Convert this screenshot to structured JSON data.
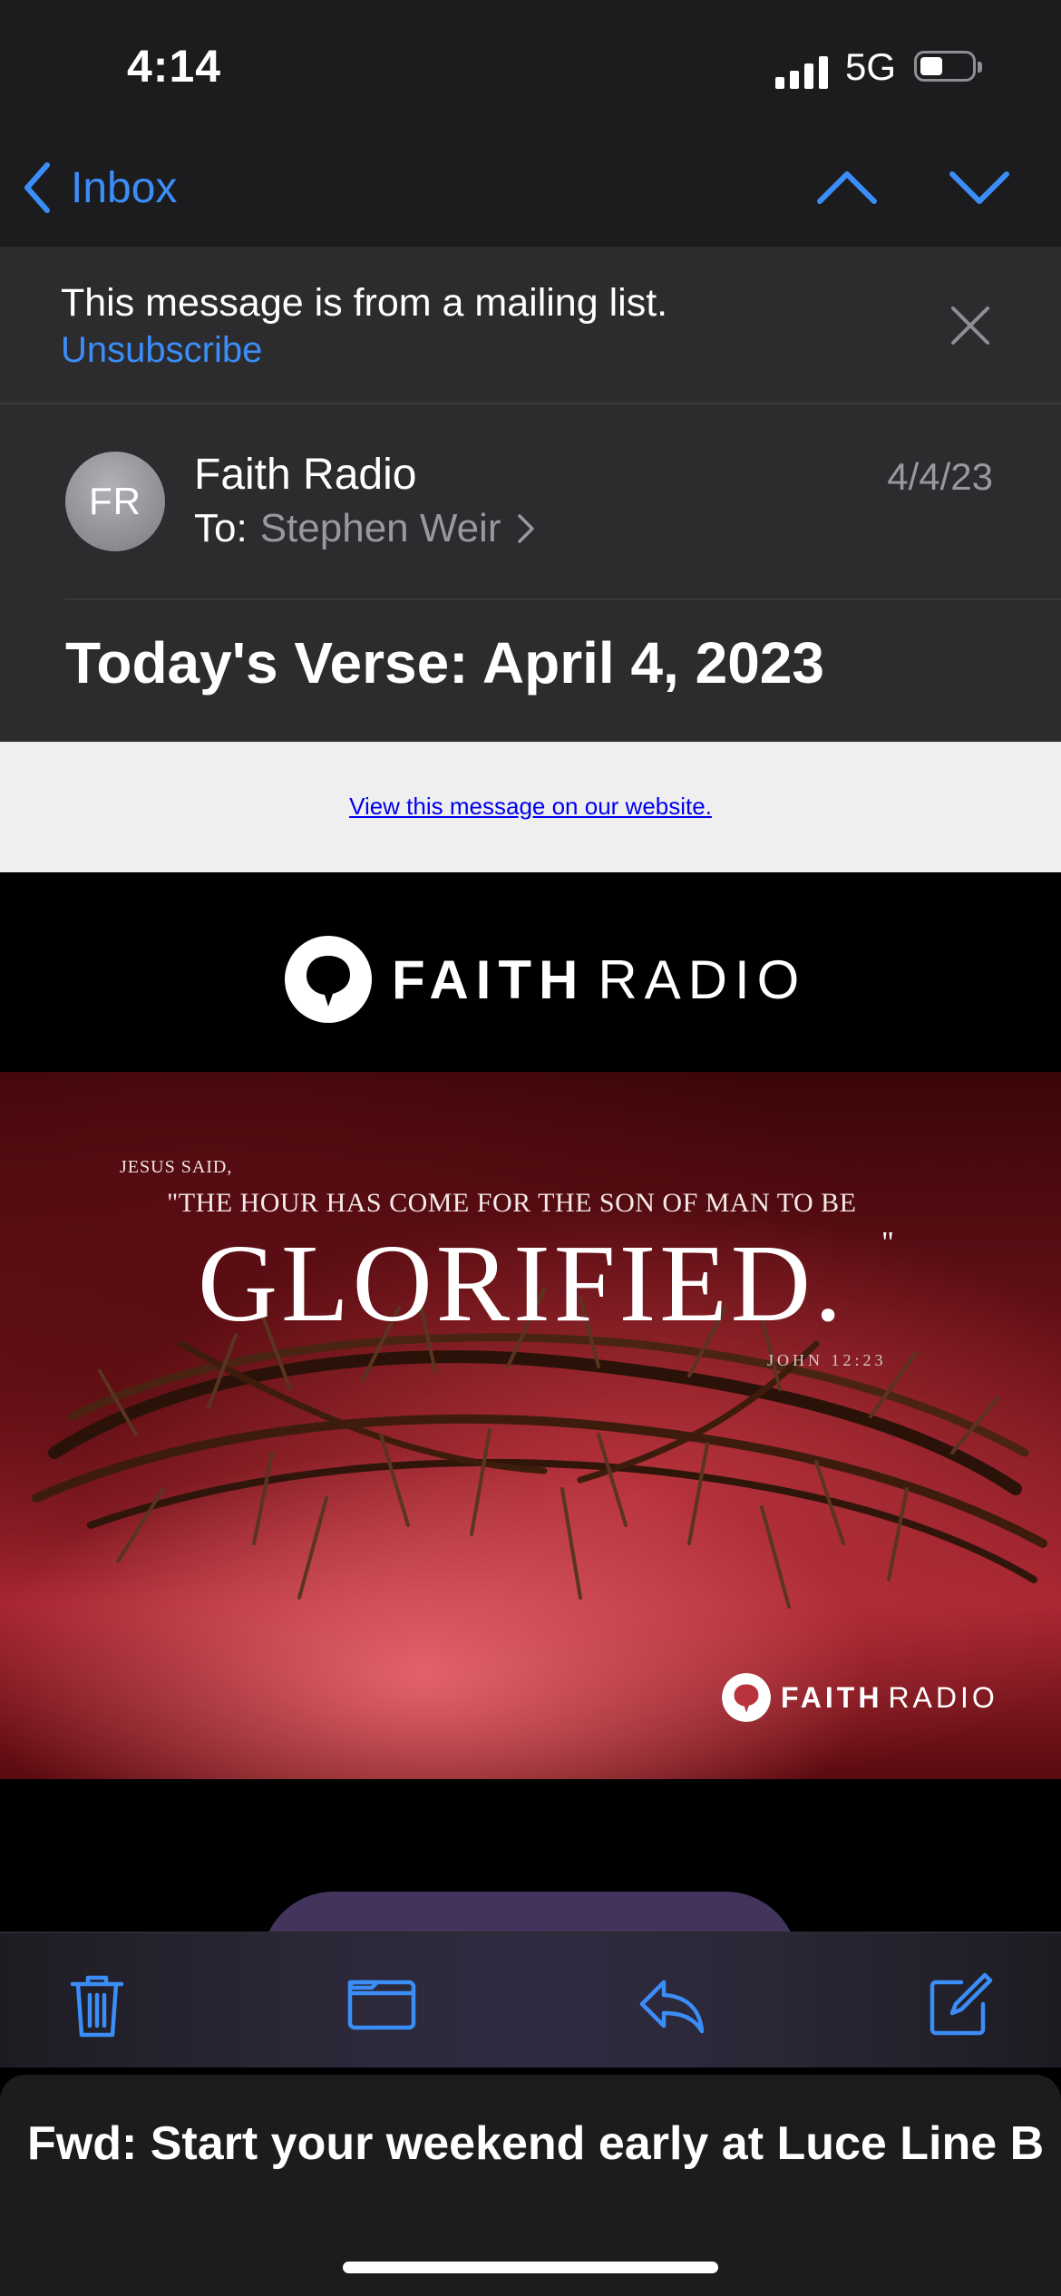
{
  "status_bar": {
    "time": "4:14",
    "network": "5G",
    "battery_percent": 45
  },
  "nav": {
    "back_label": "Inbox"
  },
  "mailing_list_banner": {
    "text": "This message is from a mailing list.",
    "unsubscribe": "Unsubscribe"
  },
  "message": {
    "avatar_initials": "FR",
    "sender": "Faith Radio",
    "to_label": "To:",
    "to_name": "Stephen Weir",
    "date": "4/4/23",
    "subject": "Today's Verse: April 4, 2023"
  },
  "body": {
    "web_link": "View this message on our website.",
    "logo_faith": "FAITH",
    "logo_radio": "RADIO",
    "hero": {
      "intro": "JESUS SAID,",
      "quote": "\"THE HOUR HAS COME FOR THE SON OF MAN TO BE",
      "emphasis": "GLORIFIED.",
      "close_quote": "\"",
      "reference": "JOHN 12:23",
      "logo_faith": "FAITH",
      "logo_radio": "RADIO"
    }
  },
  "toolbar": {
    "icons": [
      "trash-icon",
      "folder-icon",
      "reply-icon",
      "compose-icon"
    ]
  },
  "draft": {
    "title": "Fwd: Start your weekend early at Luce Line B..."
  },
  "colors": {
    "accent": "#3b8df7",
    "header_bg": "#2c2c2e",
    "hero_red": "#b8333c"
  }
}
